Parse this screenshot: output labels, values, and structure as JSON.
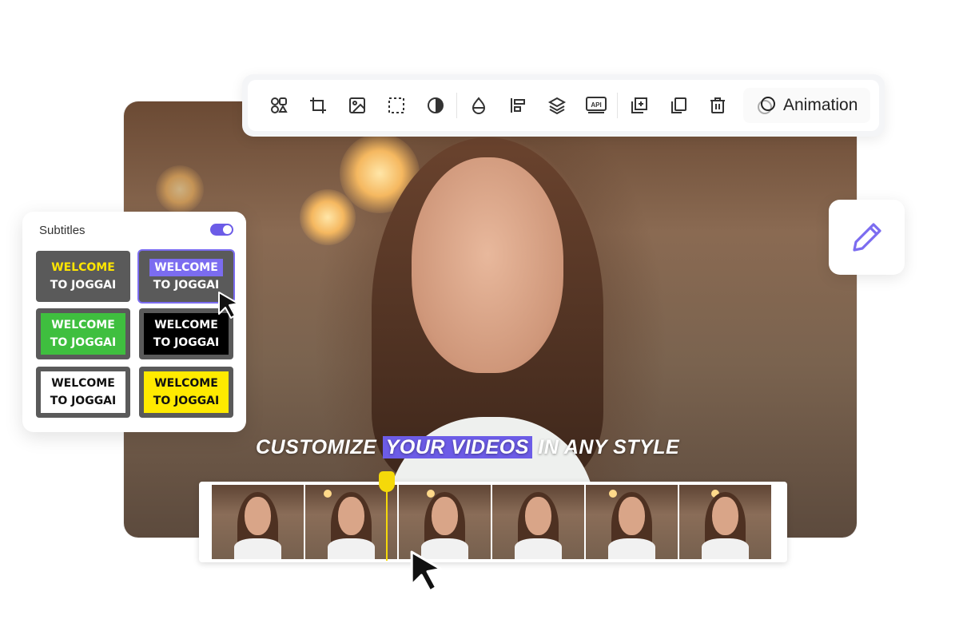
{
  "toolbar": {
    "icons": [
      "shapes-icon",
      "crop-icon",
      "image-icon",
      "dashed-square-icon",
      "contrast-icon",
      "droplet-icon",
      "align-left-icon",
      "layers-icon",
      "api-icon",
      "add-duplicate-icon",
      "copy-icon",
      "trash-icon"
    ],
    "api_label": "API",
    "animation_label": "Animation"
  },
  "subtitles": {
    "title": "Subtitles",
    "enabled": true,
    "styles": [
      {
        "line1": "WELCOME",
        "line2": "TO JOGGAI",
        "selected": false
      },
      {
        "line1": "WELCOME",
        "line2": "TO JOGGAI",
        "selected": true
      },
      {
        "line1": "WELCOME",
        "line2": "TO JOGGAI",
        "selected": false
      },
      {
        "line1": "WELCOME",
        "line2": "TO JOGGAI",
        "selected": false
      },
      {
        "line1": "WELCOME",
        "line2": "TO JOGGAI",
        "selected": false
      },
      {
        "line1": "WELCOME",
        "line2": "TO JOGGAI",
        "selected": false
      }
    ]
  },
  "caption": {
    "before": "CUSTOMIZE",
    "highlight": "YOUR VIDEOS",
    "after": "IN ANY STYLE"
  },
  "colors": {
    "accent": "#6c5ce7",
    "playhead": "#f5d90a"
  }
}
